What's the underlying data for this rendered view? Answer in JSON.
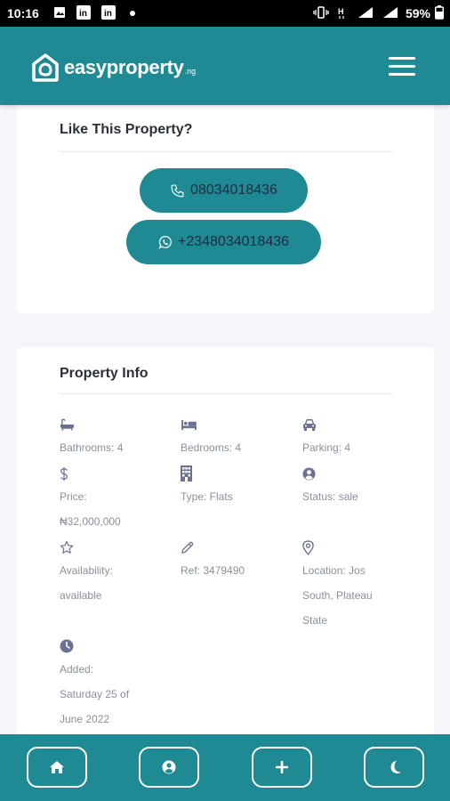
{
  "status_bar": {
    "time": "10:16",
    "battery": "59%"
  },
  "header": {
    "brand": "easyproperty",
    "tld": ".ng"
  },
  "contact_card": {
    "title": "Like This Property?",
    "phone": "08034018436",
    "whatsapp": "+2348034018436"
  },
  "info_card": {
    "title": "Property Info",
    "items": [
      {
        "icon": "bath-icon",
        "lines": [
          "Bathrooms: 4"
        ]
      },
      {
        "icon": "bed-icon",
        "lines": [
          "Bedrooms: 4"
        ]
      },
      {
        "icon": "car-icon",
        "lines": [
          "Parking: 4"
        ]
      },
      {
        "icon": "dollar-icon",
        "lines": [
          "Price:",
          "₦32,000,000"
        ]
      },
      {
        "icon": "building-icon",
        "lines": [
          "Type: Flats"
        ]
      },
      {
        "icon": "user-circle-icon",
        "lines": [
          "Status: sale"
        ]
      },
      {
        "icon": "star-icon",
        "lines": [
          "Availability:",
          "available"
        ]
      },
      {
        "icon": "pencil-icon",
        "lines": [
          "Ref: 3479490"
        ]
      },
      {
        "icon": "location-pin-icon",
        "lines": [
          "Location: Jos",
          "South, Plateau",
          "State"
        ]
      },
      {
        "icon": "clock-icon",
        "lines": [
          "Added:",
          "Saturday 25 of",
          "June 2022"
        ]
      }
    ]
  },
  "bottom_nav": [
    {
      "icon": "home-icon"
    },
    {
      "icon": "user-icon"
    },
    {
      "icon": "plus-icon"
    },
    {
      "icon": "moon-icon"
    }
  ],
  "colors": {
    "primary": "#1f8a93",
    "page_bg": "#f5f6f9",
    "card_bg": "#ffffff",
    "muted_text": "#8a8f9c",
    "icon_color": "#6b7291"
  }
}
